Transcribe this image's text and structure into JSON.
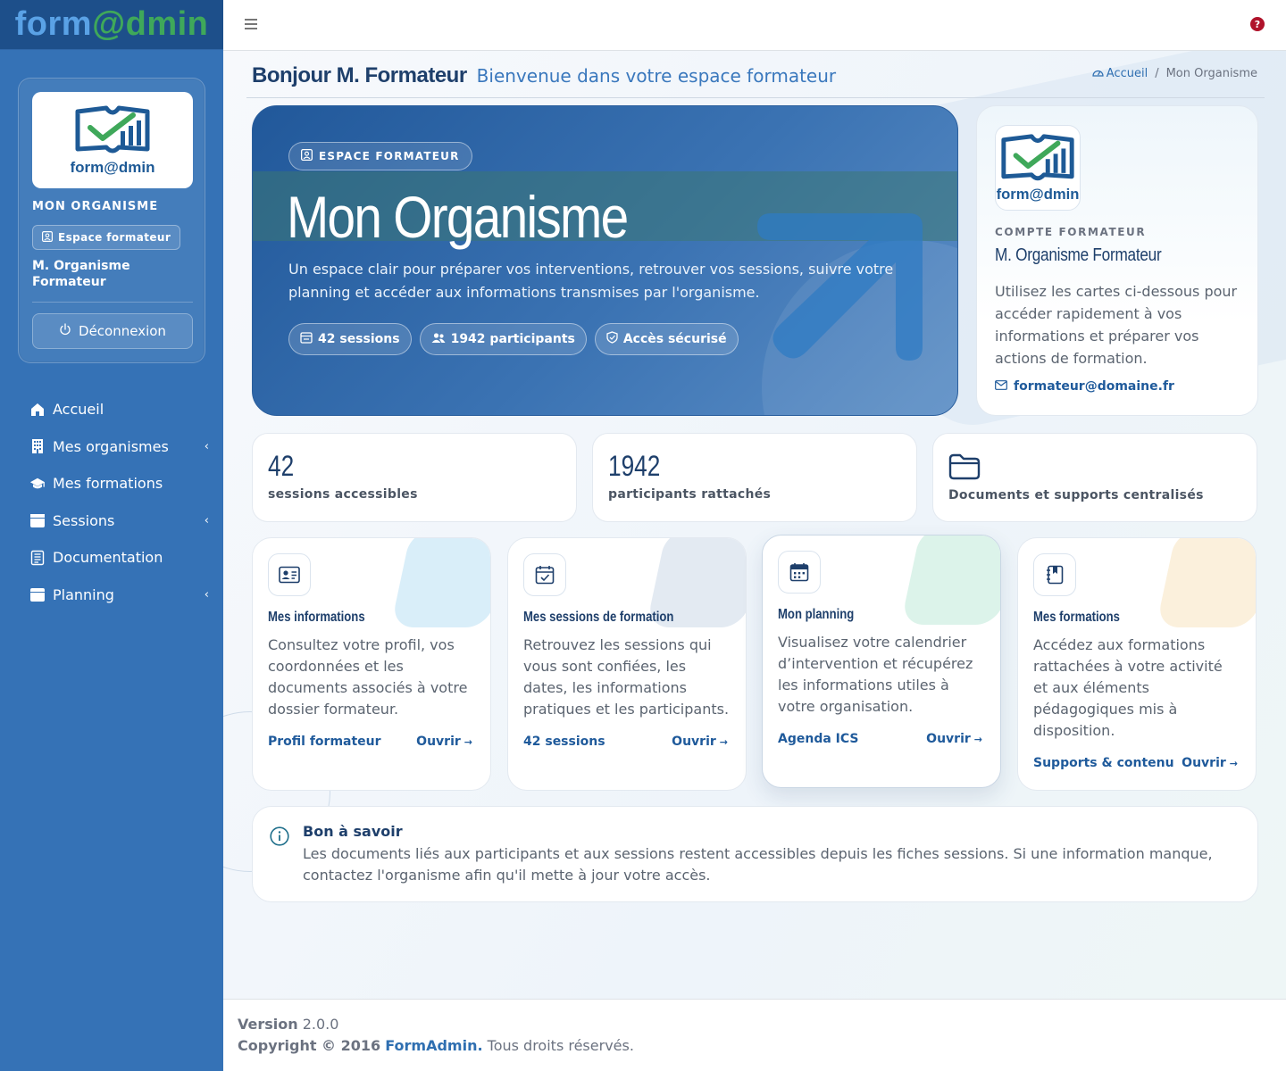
{
  "brand": {
    "part1": "form",
    "part2": "@dmin"
  },
  "sidebar": {
    "org_name": "MON ORGANISME",
    "space_badge": "Espace formateur",
    "user_name": "M. Organisme Formateur",
    "logout_label": "Déconnexion",
    "logo_text": "form@dmin",
    "items": [
      {
        "label": "Accueil",
        "icon": "home-icon",
        "has_chevron": false
      },
      {
        "label": "Mes organismes",
        "icon": "building-icon",
        "has_chevron": true
      },
      {
        "label": "Mes formations",
        "icon": "graduation-cap-icon",
        "has_chevron": false
      },
      {
        "label": "Sessions",
        "icon": "calendar-icon",
        "has_chevron": true
      },
      {
        "label": "Documentation",
        "icon": "document-icon",
        "has_chevron": false
      },
      {
        "label": "Planning",
        "icon": "calendar-icon",
        "has_chevron": true
      }
    ]
  },
  "topbar": {
    "help_glyph": "?"
  },
  "header": {
    "hello": "Bonjour M. Formateur",
    "subtitle": "Bienvenue dans votre espace formateur",
    "breadcrumb_home": "Accueil",
    "breadcrumb_current": "Mon Organisme"
  },
  "hero": {
    "badge": "ESPACE FORMATEUR",
    "title": "Mon Organisme",
    "description": "Un espace clair pour préparer vos interventions, retrouver vos sessions, suivre votre planning et accéder aux informations transmises par l'organisme.",
    "chips": [
      {
        "label": "42 sessions",
        "icon": "calendar-icon"
      },
      {
        "label": "1942 participants",
        "icon": "users-icon"
      },
      {
        "label": "Accès sécurisé",
        "icon": "shield-icon"
      }
    ]
  },
  "profile": {
    "logo_text": "form@dmin",
    "label": "COMPTE FORMATEUR",
    "name": "M. Organisme Formateur",
    "description": "Utilisez les cartes ci-dessous pour accéder rapidement à vos informations et préparer vos actions de formation.",
    "email": "formateur@domaine.fr"
  },
  "stats": [
    {
      "value": "42",
      "label": "sessions accessibles"
    },
    {
      "value": "1942",
      "label": "participants rattachés"
    },
    {
      "value": "",
      "label": "Documents et supports centralisés"
    }
  ],
  "features": [
    {
      "title": "Mes informations",
      "description": "Consultez votre profil, vos coordonnées et les documents associés à votre dossier formateur.",
      "link": "Profil formateur",
      "open": "Ouvrir",
      "icon": "id-card-icon",
      "accent": "#d9eef9"
    },
    {
      "title": "Mes sessions de formation",
      "description": "Retrouvez les sessions qui vous sont confiées, les dates, les informations pratiques et les participants.",
      "link": "42 sessions",
      "open": "Ouvrir",
      "icon": "calendar-check-icon",
      "accent": "#e3eaf2"
    },
    {
      "title": "Mon planning",
      "description": "Visualisez votre calendrier d’intervention et récupérez les informations utiles à votre organisation.",
      "link": "Agenda ICS",
      "open": "Ouvrir",
      "icon": "calendar-icon",
      "accent": "#dcf3ea"
    },
    {
      "title": "Mes formations",
      "description": "Accédez aux formations rattachées à votre activité et aux éléments pédagogiques mis à disposition.",
      "link": "Supports & contenu",
      "open": "Ouvrir",
      "icon": "book-icon",
      "accent": "#fbf0dc"
    }
  ],
  "info": {
    "title": "Bon à savoir",
    "text": "Les documents liés aux participants et aux sessions restent accessibles depuis les fiches sessions. Si une information manque, contactez l'organisme afin qu'il mette à jour votre accès."
  },
  "footer": {
    "version_label": "Version",
    "version": "2.0.0",
    "copyright": "Copyright © 2016",
    "company": "FormAdmin.",
    "rights": "Tous droits réservés."
  }
}
